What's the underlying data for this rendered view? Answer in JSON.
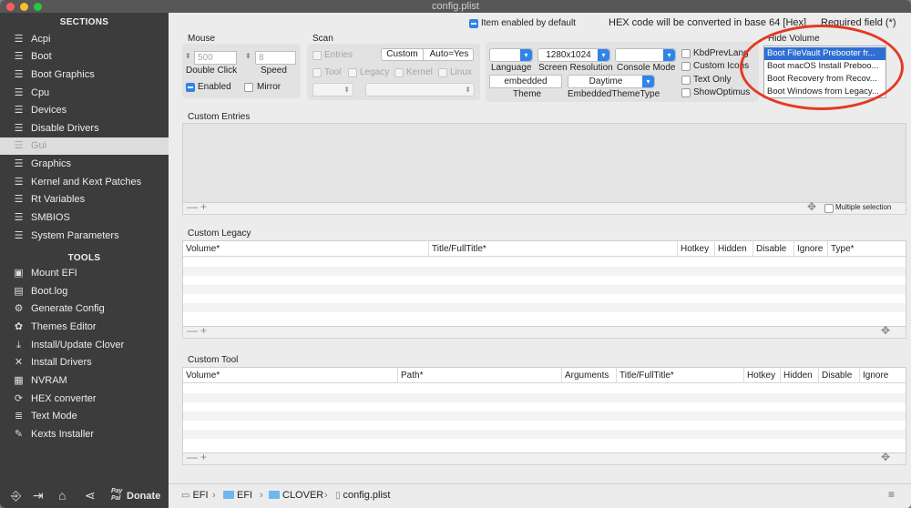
{
  "window": {
    "title": "config.plist"
  },
  "sidebar": {
    "sections_heading": "SECTIONS",
    "sections": [
      {
        "label": "Acpi",
        "icon": "list-icon"
      },
      {
        "label": "Boot",
        "icon": "list-icon"
      },
      {
        "label": "Boot Graphics",
        "icon": "list-icon"
      },
      {
        "label": "Cpu",
        "icon": "list-icon"
      },
      {
        "label": "Devices",
        "icon": "list-icon"
      },
      {
        "label": "Disable Drivers",
        "icon": "list-icon"
      },
      {
        "label": "Gui",
        "icon": "list-icon",
        "selected": true
      },
      {
        "label": "Graphics",
        "icon": "list-icon"
      },
      {
        "label": "Kernel and Kext Patches",
        "icon": "list-icon"
      },
      {
        "label": "Rt Variables",
        "icon": "list-icon"
      },
      {
        "label": "SMBIOS",
        "icon": "list-icon"
      },
      {
        "label": "System Parameters",
        "icon": "list-icon"
      }
    ],
    "tools_heading": "TOOLS",
    "tools": [
      {
        "label": "Mount EFI",
        "icon": "disk-icon"
      },
      {
        "label": "Boot.log",
        "icon": "log-icon"
      },
      {
        "label": "Generate Config",
        "icon": "gear-icon"
      },
      {
        "label": "Themes Editor",
        "icon": "palette-icon"
      },
      {
        "label": "Install/Update Clover",
        "icon": "download-icon"
      },
      {
        "label": "Install Drivers",
        "icon": "drivers-icon"
      },
      {
        "label": "NVRAM",
        "icon": "chip-icon"
      },
      {
        "label": "HEX converter",
        "icon": "refresh-icon"
      },
      {
        "label": "Text Mode",
        "icon": "text-icon"
      },
      {
        "label": "Kexts Installer",
        "icon": "wrench-icon"
      }
    ],
    "bottom": {
      "donate_label": "Donate",
      "paypal_label": "Pay Pal"
    }
  },
  "header": {
    "item_enabled_default": "Item enabled by default",
    "hex_note": "HEX code will be converted in base 64 [Hex]",
    "required_note": "Required field (*)"
  },
  "mouse": {
    "title": "Mouse",
    "double_click_value": "500",
    "speed_value": "8",
    "double_click_label": "Double Click",
    "speed_label": "Speed",
    "enabled_label": "Enabled",
    "mirror_label": "Mirror"
  },
  "scan": {
    "title": "Scan",
    "entries_label": "Entries",
    "custom_label": "Custom",
    "auto_label": "Auto=Yes",
    "tool_label": "Tool",
    "legacy_label": "Legacy",
    "kernel_label": "Kernel",
    "linux_label": "Linux"
  },
  "gui_opts": {
    "language_label": "Language",
    "resolution_value": "1280x1024",
    "resolution_label": "Screen Resolution",
    "console_label": "Console Mode",
    "theme_value": "embedded",
    "theme_label": "Theme",
    "embedded_type_value": "Daytime",
    "embedded_type_label": "EmbeddedThemeType",
    "kbd_label": "KbdPrevLang",
    "custom_icons_label": "Custom Icons",
    "text_only_label": "Text Only",
    "show_optimus_label": "ShowOptimus"
  },
  "hide_volume": {
    "title": "Hide Volume",
    "items": [
      "Boot FileVault Prebooter fr...",
      "Boot macOS Install Preboo...",
      "Boot Recovery from Recov...",
      "Boot Windows from Legacy..."
    ]
  },
  "custom_entries": {
    "title": "Custom Entries",
    "multiple_selection": "Multiple selection"
  },
  "custom_legacy": {
    "title": "Custom Legacy",
    "columns": [
      "Volume*",
      "Title/FullTitle*",
      "Hotkey",
      "Hidden",
      "Disable",
      "Ignore",
      "Type*"
    ]
  },
  "custom_tool": {
    "title": "Custom Tool",
    "columns": [
      "Volume*",
      "Path*",
      "Arguments",
      "Title/FullTitle*",
      "Hotkey",
      "Hidden",
      "Disable",
      "Ignore"
    ]
  },
  "pathbar": {
    "crumbs": [
      "EFI",
      "EFI",
      "CLOVER",
      "config.plist"
    ]
  },
  "colors": {
    "accent": "#2f84ea",
    "sidebar": "#3c3c3c",
    "highlight": "#e33a24"
  }
}
